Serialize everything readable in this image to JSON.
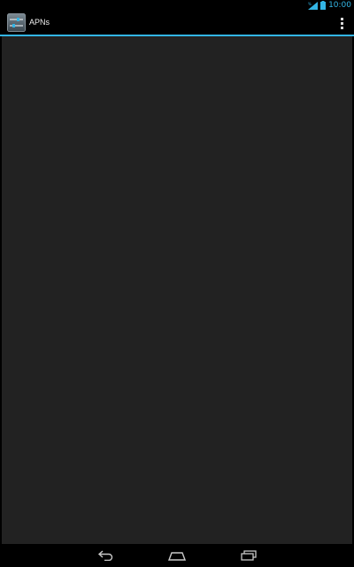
{
  "status_bar": {
    "time": "10:00",
    "icons": [
      "signal-icon",
      "battery-icon"
    ],
    "accent_color": "#33b5e5"
  },
  "action_bar": {
    "title": "APNs",
    "app_icon": "settings-sliders-icon",
    "overflow_icon": "overflow-menu-icon",
    "divider_color": "#33b5e5"
  },
  "content": {
    "background_color": "#222222"
  },
  "nav_bar": {
    "buttons": [
      "back-icon",
      "home-icon",
      "recents-icon"
    ]
  }
}
